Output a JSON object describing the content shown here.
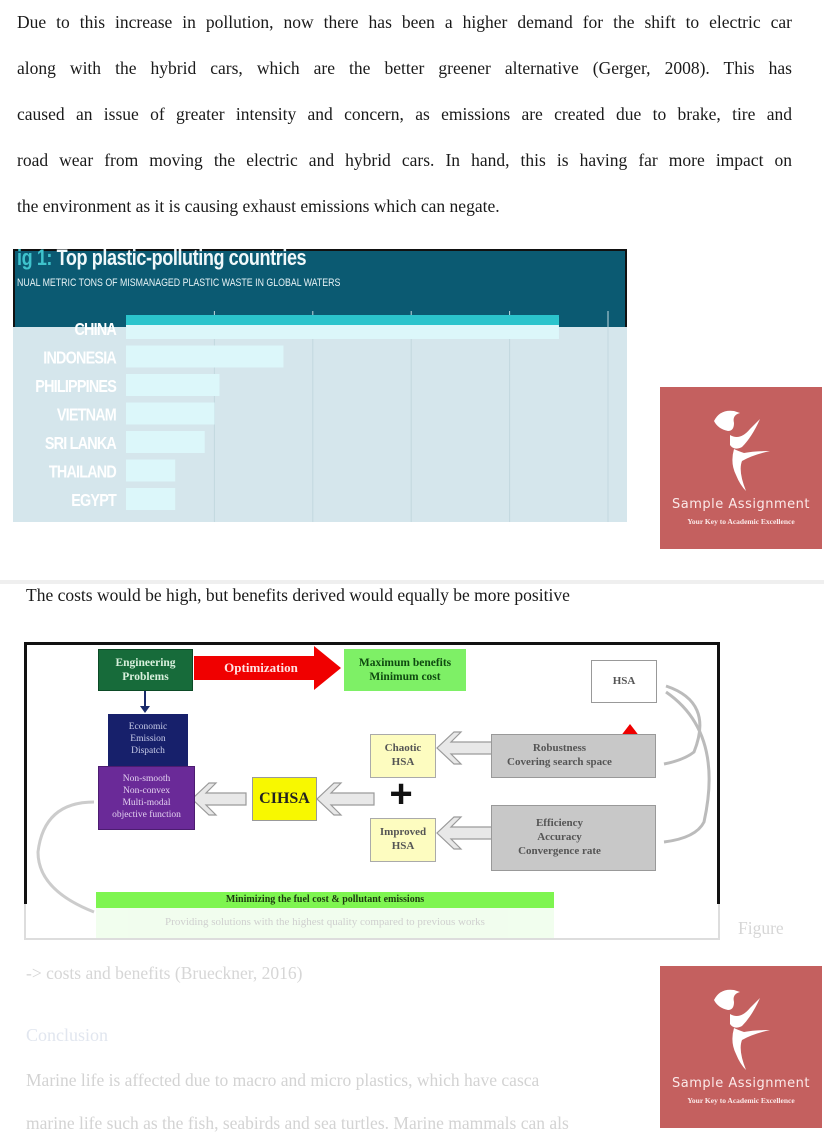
{
  "intro_paragraph": {
    "lines": [
      "Due to this increase in pollution, now there has been a higher demand for the shift to electric car",
      "along with the hybrid cars, which are the better greener alternative (Gerger, 2008). This has",
      "caused an issue of greater intensity and concern, as emissions are created due to brake, tire and",
      "road wear from moving the electric and hybrid cars. In hand, this is having far more impact  on",
      "the environment as it is causing exhaust emissions which can negate."
    ]
  },
  "figure_chart": {
    "title_prefix": "ig 1:",
    "title": "Top plastic-polluting countries",
    "subtitle": "NUAL METRIC TONS OF MISMANAGED PLASTIC WASTE IN GLOBAL WATERS",
    "colors": {
      "header_bg": "#0b5a72",
      "bar_top": "#2bc4cc",
      "bar": "#dcf7fa",
      "overlay": "#d5e6ec"
    }
  },
  "chart_data": {
    "type": "bar",
    "orientation": "horizontal",
    "title": "Top plastic-polluting countries",
    "subtitle": "Annual metric tons of mismanaged plastic waste in global waters",
    "categories": [
      "CHINA",
      "INDONESIA",
      "PHILIPPINES",
      "VIETNAM",
      "SRI LANKA",
      "THAILAND",
      "EGYPT"
    ],
    "values": [
      8.8,
      3.2,
      1.9,
      1.8,
      1.6,
      1.0,
      1.0
    ],
    "xlim": [
      0,
      10
    ],
    "grid": true,
    "xlabel": "",
    "ylabel": "",
    "note": "values estimated relative to gridlines (axis ticks not visible)"
  },
  "logos": [
    {
      "name": "Sample Assignment",
      "tagline": "Your Key to Academic Excellence"
    },
    {
      "name": "Sample Assignment",
      "tagline": "Your Key to Academic Excellence"
    }
  ],
  "cost_sentence": "The costs would be high, but benefits derived would equally be more positive",
  "diagram": {
    "engineering_problems": "Engineering\nProblems",
    "optimization": "Optimization",
    "max_benefits": "Maximum benefits\nMinimum cost",
    "hsa": "HSA",
    "economic_dispatch": "Economic\nEmission\nDispatch",
    "objective": "Non-smooth\nNon-convex\nMulti-modal\nobjective function",
    "cihsa": "CIHSA",
    "plus": "+",
    "chaotic_hsa": "Chaotic\nHSA",
    "improved_hsa": "Improved\nHSA",
    "robustness": "Robustness\nCovering search space",
    "efficiency": "Efficiency\nAccuracy\nConvergence rate",
    "minimizing": "Minimizing the fuel cost & pollutant emissions",
    "providing": "Providing solutions with the highest quality compared to previous works"
  },
  "figure_caption_word": "Figure",
  "figure_caption_line": "-> costs and benefits (Brueckner, 2016)",
  "conclusion": {
    "heading": "Conclusion",
    "lines": [
      "Marine life is affected due to macro and micro plastics, which have casca",
      "marine life such as the fish, seabirds and sea turtles. Marine mammals can als"
    ]
  }
}
